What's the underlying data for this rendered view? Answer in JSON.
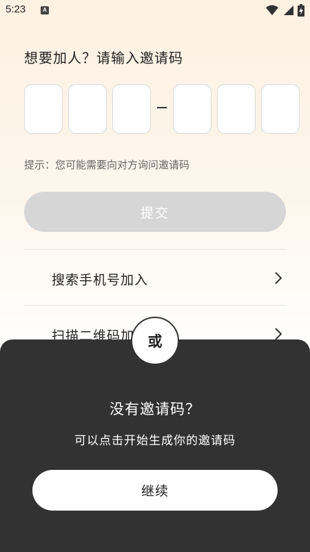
{
  "status_bar": {
    "time": "5:23",
    "app_indicator": "A",
    "icons": [
      "wifi-icon",
      "signal-icon",
      "battery-charging-icon"
    ]
  },
  "join": {
    "title": "想要加人？请输入邀请码",
    "code_boxes": [
      "",
      "",
      "",
      "",
      "",
      ""
    ],
    "hint": "提示：您可能需要向对方询问邀请码",
    "submit_label": "提交"
  },
  "options": [
    {
      "label": "搜索手机号加入",
      "icon": "chevron-right-icon"
    },
    {
      "label": "扫描二维码加入",
      "icon": "chevron-right-icon"
    }
  ],
  "sheet": {
    "or_label": "或",
    "title": "没有邀请码？",
    "description": "可以点击开始生成你的邀请码",
    "continue_label": "继续"
  },
  "colors": {
    "sheet_background": "#323232",
    "submit_disabled": "#d6d6d6",
    "page_gradient_top": "#fdf1e2"
  }
}
